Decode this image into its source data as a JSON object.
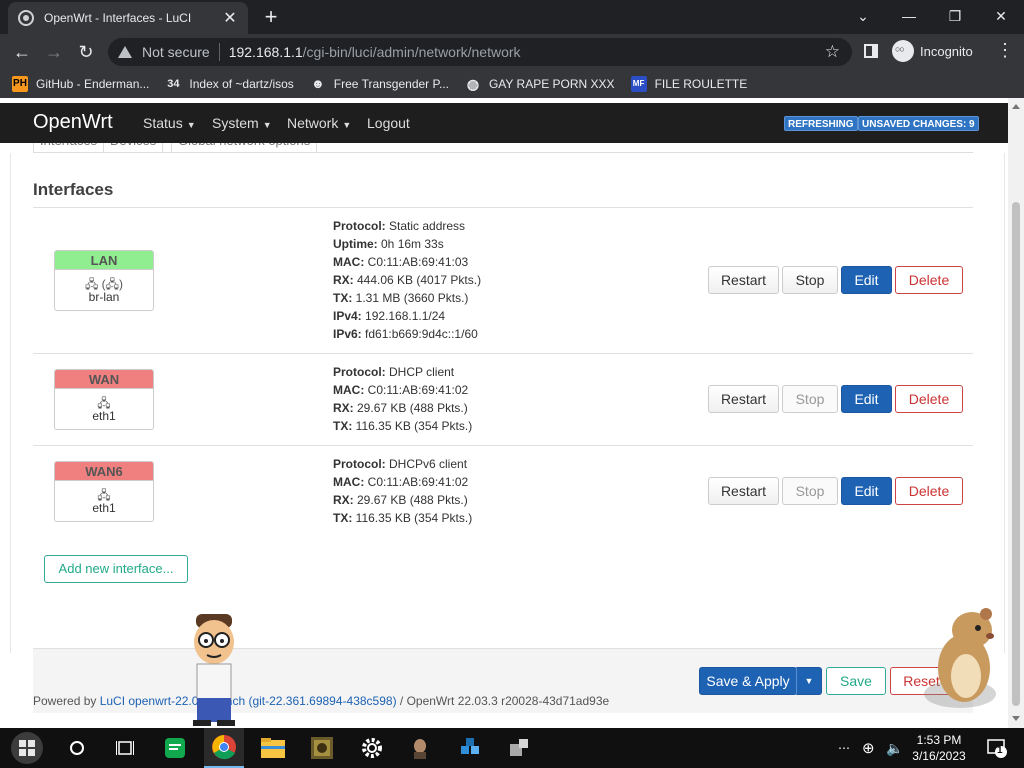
{
  "browser": {
    "tab_title": "OpenWrt - Interfaces - LuCI",
    "new_tab_symbol": "+",
    "security_label": "Not secure",
    "url_host": "192.168.1.1",
    "url_path": "/cgi-bin/luci/admin/network/network",
    "incognito_label": "Incognito"
  },
  "bookmarks": [
    {
      "label": "GitHub - Enderman...",
      "icon": "PH"
    },
    {
      "label": "Index of ~dartz/isos",
      "icon": "34"
    },
    {
      "label": "Free Transgender P...",
      "icon": ""
    },
    {
      "label": "GAY RAPE PORN XXX",
      "icon": ""
    },
    {
      "label": "FILE ROULETTE",
      "icon": "MF"
    }
  ],
  "luci": {
    "brand": "OpenWrt",
    "menu": [
      {
        "label": "Status"
      },
      {
        "label": "System"
      },
      {
        "label": "Network"
      },
      {
        "label": "Logout"
      }
    ],
    "badges": {
      "refreshing": "REFRESHING",
      "unsaved": "UNSAVED CHANGES: 9"
    },
    "tabs": [
      "Interfaces",
      "Devices",
      "Global network options"
    ],
    "section_title": "Interfaces",
    "interfaces": [
      {
        "name": "LAN",
        "color": "#90ee90",
        "icons": "🖧 (🖧)",
        "device": "br-lan",
        "info": [
          {
            "k": "Protocol:",
            "v": " Static address"
          },
          {
            "k": "Uptime:",
            "v": " 0h 16m 33s"
          },
          {
            "k": "MAC:",
            "v": " C0:11:AB:69:41:03"
          },
          {
            "k": "RX:",
            "v": " 444.06 KB (4017 Pkts.)"
          },
          {
            "k": "TX:",
            "v": " 1.31 MB (3660 Pkts.)"
          },
          {
            "k": "IPv4:",
            "v": " 192.168.1.1/24"
          },
          {
            "k": "IPv6:",
            "v": " fd61:b669:9d4c::1/60"
          }
        ],
        "stop_enabled": true
      },
      {
        "name": "WAN",
        "color": "#f08080",
        "icons": "🖧",
        "device": "eth1",
        "info": [
          {
            "k": "Protocol:",
            "v": " DHCP client"
          },
          {
            "k": "MAC:",
            "v": " C0:11:AB:69:41:02"
          },
          {
            "k": "RX:",
            "v": " 29.67 KB (488 Pkts.)"
          },
          {
            "k": "TX:",
            "v": " 116.35 KB (354 Pkts.)"
          }
        ],
        "stop_enabled": false
      },
      {
        "name": "WAN6",
        "color": "#f08080",
        "icons": "🖧",
        "device": "eth1",
        "info": [
          {
            "k": "Protocol:",
            "v": " DHCPv6 client"
          },
          {
            "k": "MAC:",
            "v": " C0:11:AB:69:41:02"
          },
          {
            "k": "RX:",
            "v": " 29.67 KB (488 Pkts.)"
          },
          {
            "k": "TX:",
            "v": " 116.35 KB (354 Pkts.)"
          }
        ],
        "stop_enabled": false
      }
    ],
    "row_buttons": {
      "restart": "Restart",
      "stop": "Stop",
      "edit": "Edit",
      "delete": "Delete"
    },
    "add_interface": "Add new interface...",
    "actions": {
      "save_apply": "Save & Apply",
      "save": "Save",
      "reset": "Reset"
    },
    "footer": {
      "powered_prefix": "Powered by ",
      "luci_link": "LuCI openwrt-22.03 branch (git-22.361.69894-438c598)",
      "release": " / OpenWrt 22.03.3 r20028-43d71ad93e"
    }
  },
  "taskbar": {
    "time": "1:53 PM",
    "date": "3/16/2023",
    "notification_count": "1"
  },
  "colors": {
    "accent": "#1d62b3",
    "negative": "#cc3333",
    "positive": "#22aa88"
  }
}
